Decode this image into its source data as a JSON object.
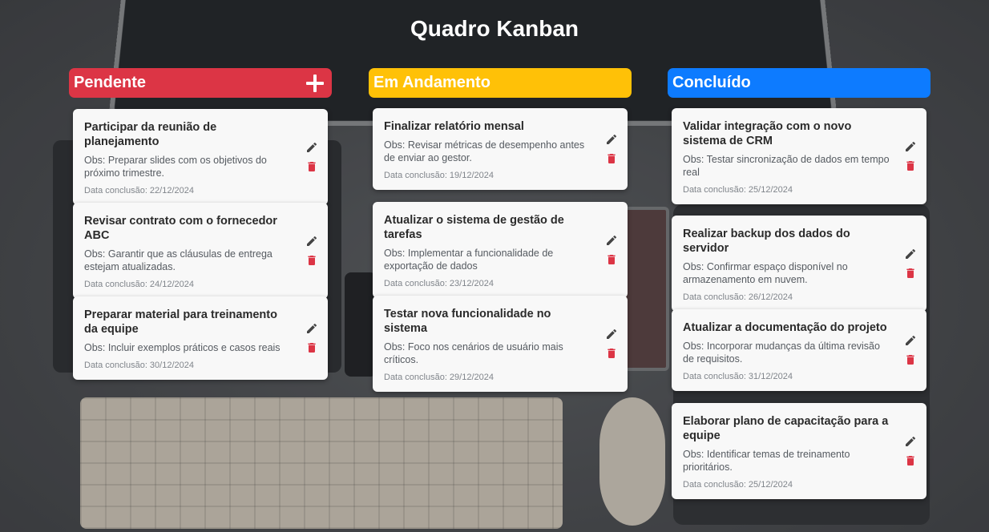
{
  "board": {
    "title": "Quadro Kanban"
  },
  "colors": {
    "pendente": "#dc3545",
    "andamento": "#ffc107",
    "concluido": "#0d7bff",
    "delete": "#dc3545",
    "edit": "#444444"
  },
  "columns": [
    {
      "title": "Pendente",
      "add_icon": "plus-icon",
      "cards": [
        {
          "title": "Participar da reunião de planejamento",
          "obs": "Obs: Preparar slides com os objetivos do próximo trimestre.",
          "date": "Data conclusão: 22/12/2024"
        },
        {
          "title": "Revisar contrato com o fornecedor ABC",
          "obs": "Obs: Garantir que as cláusulas de entrega estejam atualizadas.",
          "date": "Data conclusão: 24/12/2024"
        },
        {
          "title": "Preparar material para treinamento da equipe",
          "obs": "Obs: Incluir exemplos práticos e casos reais",
          "date": "Data conclusão: 30/12/2024"
        }
      ]
    },
    {
      "title": "Em Andamento",
      "cards": [
        {
          "title": "Finalizar relatório mensal",
          "obs": "Obs: Revisar métricas de desempenho antes de enviar ao gestor.",
          "date": "Data conclusão: 19/12/2024"
        },
        {
          "title": "Atualizar o sistema de gestão de tarefas",
          "obs": "Obs: Implementar a funcionalidade de exportação de dados",
          "date": "Data conclusão: 23/12/2024"
        },
        {
          "title": "Testar nova funcionalidade no sistema",
          "obs": "Obs: Foco nos cenários de usuário mais críticos.",
          "date": "Data conclusão: 29/12/2024"
        }
      ]
    },
    {
      "title": "Concluído",
      "cards": [
        {
          "title": "Validar integração com o novo sistema de CRM",
          "obs": "Obs: Testar sincronização de dados em tempo real",
          "date": "Data conclusão: 25/12/2024"
        },
        {
          "title": "Realizar backup dos dados do servidor",
          "obs": "Obs: Confirmar espaço disponível no armazenamento em nuvem.",
          "date": "Data conclusão: 26/12/2024"
        },
        {
          "title": "Atualizar a documentação do projeto",
          "obs": "Obs: Incorporar mudanças da última revisão de requisitos.",
          "date": "Data conclusão: 31/12/2024"
        },
        {
          "title": "Elaborar plano de capacitação para a equipe",
          "obs": "Obs: Identificar temas de treinamento prioritários.",
          "date": "Data conclusão: 25/12/2024"
        }
      ]
    }
  ],
  "icons": {
    "edit": "pencil-icon",
    "delete": "trash-icon"
  }
}
